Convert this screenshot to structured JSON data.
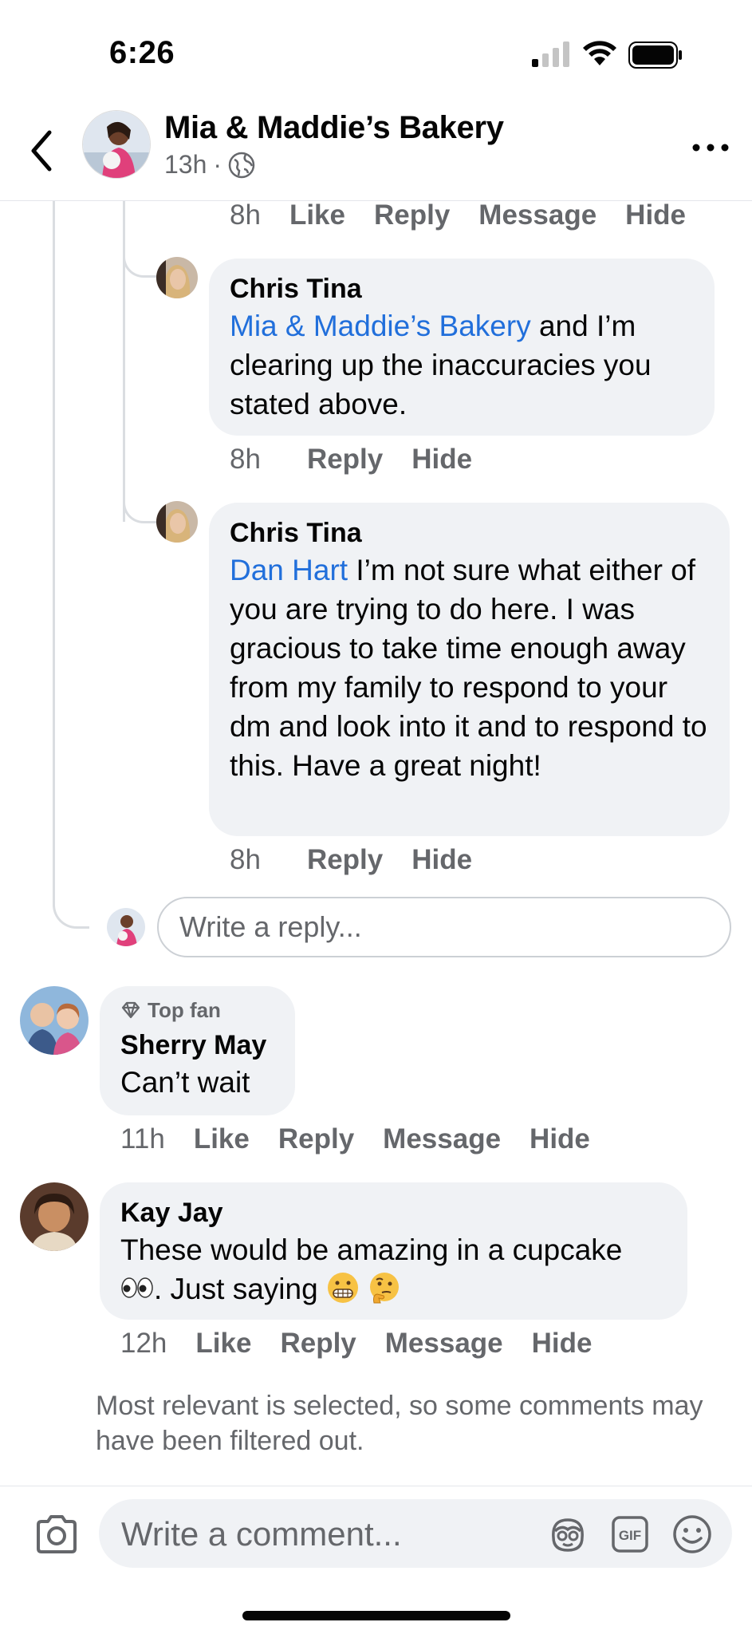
{
  "status_bar": {
    "time": "6:26"
  },
  "header": {
    "page_name": "Mia & Maddie’s Bakery",
    "post_age": "13h",
    "separator": "·"
  },
  "top_actions": {
    "time": "8h",
    "like": "Like",
    "reply": "Reply",
    "message": "Message",
    "hide": "Hide"
  },
  "replies": [
    {
      "author": "Chris Tina",
      "mention": "Mia & Maddie’s Bakery",
      "text": " and I’m clearing up the inaccuracies you stated above.",
      "time": "8h",
      "reply": "Reply",
      "hide": "Hide"
    },
    {
      "author": "Chris Tina",
      "mention": "Dan Hart",
      "text": " I’m not sure what either of you are trying to do here. I was gracious to take time enough away from my family to respond to your dm and look into it and to respond to this. Have a great night!",
      "time": "8h",
      "reply": "Reply",
      "hide": "Hide"
    }
  ],
  "reply_input": {
    "placeholder": "Write a reply..."
  },
  "comments": [
    {
      "badge": "Top fan",
      "author": "Sherry May",
      "text": "Can’t wait",
      "time": "11h",
      "like": "Like",
      "reply": "Reply",
      "message": "Message",
      "hide": "Hide"
    },
    {
      "author": "Kay Jay",
      "text_line1": "These would be amazing in a cupcake",
      "text_line2": ". Just saying",
      "time": "12h",
      "like": "Like",
      "reply": "Reply",
      "message": "Message",
      "hide": "Hide"
    }
  ],
  "filter_note": "Most relevant is selected, so some comments may have been filtered out.",
  "composer": {
    "placeholder": "Write a comment..."
  },
  "colors": {
    "mention": "#216fdb",
    "bubble": "#f0f2f5",
    "secondary_text": "#65676b"
  }
}
